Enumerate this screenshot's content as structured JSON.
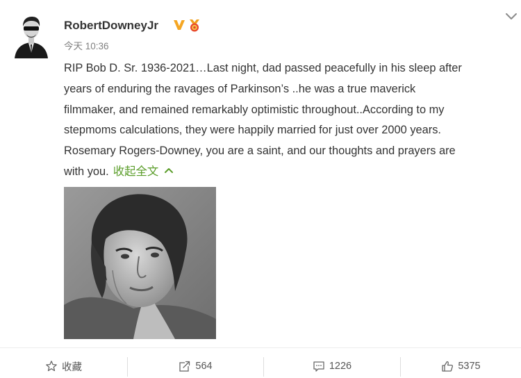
{
  "post": {
    "username": "RobertDowneyJr",
    "timestamp": "今天 10:36",
    "text_lines": [
      "RIP Bob D. Sr. 1936-2021…Last night, dad passed peacefully in his sleep after",
      "years of enduring the ravages of Parkinson’s ..he was a true maverick",
      "filmmaker, and remained remarkably optimistic throughout..According to my",
      "stepmoms calculations, they were happily married for just over 2000 years.",
      "Rosemary Rogers-Downey, you are a saint, and our thoughts and prayers are",
      "with you."
    ],
    "collapse_label": "收起全文",
    "icons": {
      "verified": "verified-v-icon",
      "medal": "medal-icon",
      "more": "chevron-down-icon",
      "collapse": "chevron-up-icon"
    }
  },
  "actions": {
    "favorite_label": "收藏",
    "repost_count": "564",
    "comment_count": "1226",
    "like_count": "5375"
  },
  "colors": {
    "accent_green": "#5b9d2a",
    "verified_orange": "#f5a623",
    "text": "#333333",
    "muted": "#808080"
  }
}
